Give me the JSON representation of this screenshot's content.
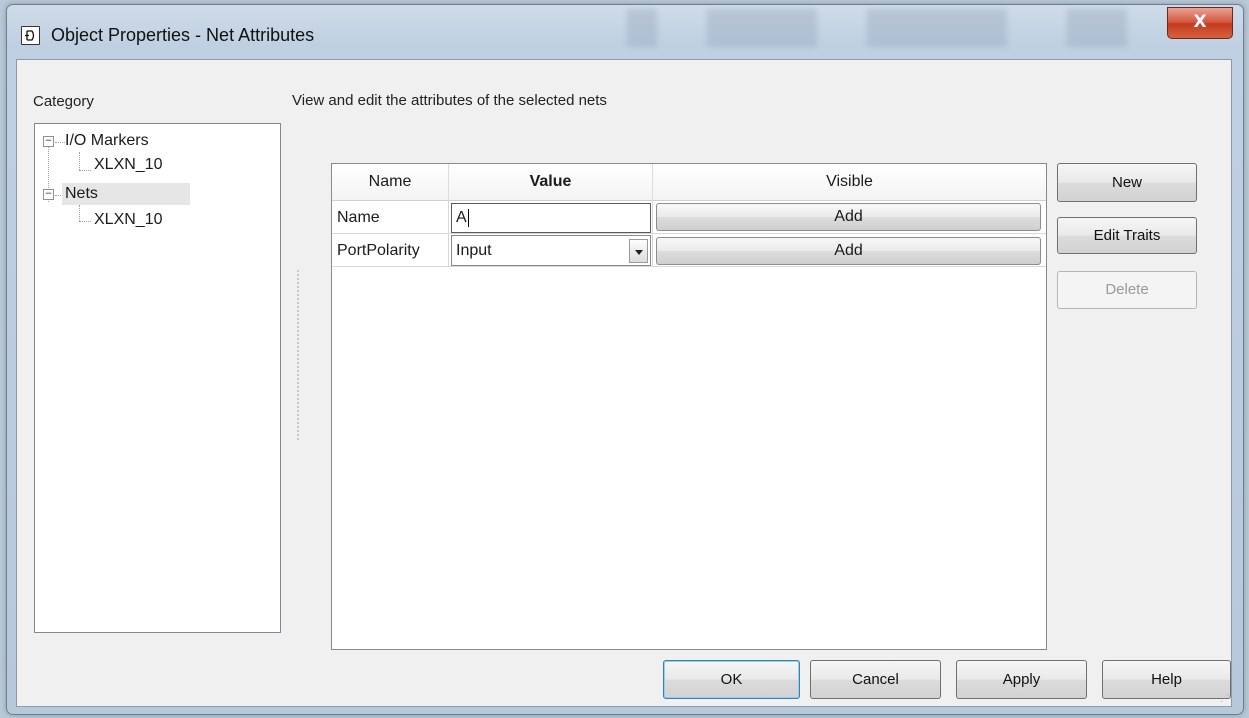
{
  "window": {
    "title": "Object Properties - Net Attributes",
    "close_label": "X"
  },
  "category_label": "Category",
  "description": "View and edit the attributes of the selected nets",
  "tree": {
    "items": [
      {
        "label": "I/O Markers",
        "expander": "−"
      },
      {
        "label": "XLXN_10"
      },
      {
        "label": "Nets",
        "expander": "−"
      },
      {
        "label": "XLXN_10"
      }
    ]
  },
  "table": {
    "columns": [
      "Name",
      "Value",
      "Visible"
    ],
    "rows": [
      {
        "name": "Name",
        "value": "A",
        "visible": "Add"
      },
      {
        "name": "PortPolarity",
        "value": "Input",
        "visible": "Add"
      }
    ]
  },
  "side_buttons": {
    "new": "New",
    "edit_traits": "Edit Traits",
    "delete": "Delete"
  },
  "footer_buttons": {
    "ok": "OK",
    "cancel": "Cancel",
    "apply": "Apply",
    "help": "Help"
  }
}
